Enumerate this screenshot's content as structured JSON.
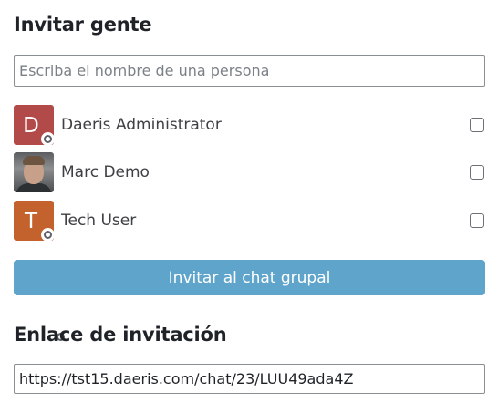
{
  "invite": {
    "title": "Invitar gente",
    "search_placeholder": "Escriba el nombre de una persona",
    "users": [
      {
        "name": "Daeris Administrator",
        "initial": "D",
        "avatar_color": "#b24a49",
        "avatar": "letter",
        "checked": false
      },
      {
        "name": "Marc Demo",
        "initial": "",
        "avatar_color": "#6a6c6f",
        "avatar": "photo",
        "checked": false
      },
      {
        "name": "Tech User",
        "initial": "T",
        "avatar_color": "#c4622e",
        "avatar": "letter",
        "checked": false
      }
    ],
    "button_label": "Invitar al chat grupal",
    "button_color": "#5ea4cb"
  },
  "link": {
    "title": "Enlace de invitación",
    "url": "https://tst15.daeris.com/chat/23/LUU49ada4Z"
  },
  "icons": {
    "status": "offline-status-icon",
    "avatar_photo": "user-photo"
  }
}
